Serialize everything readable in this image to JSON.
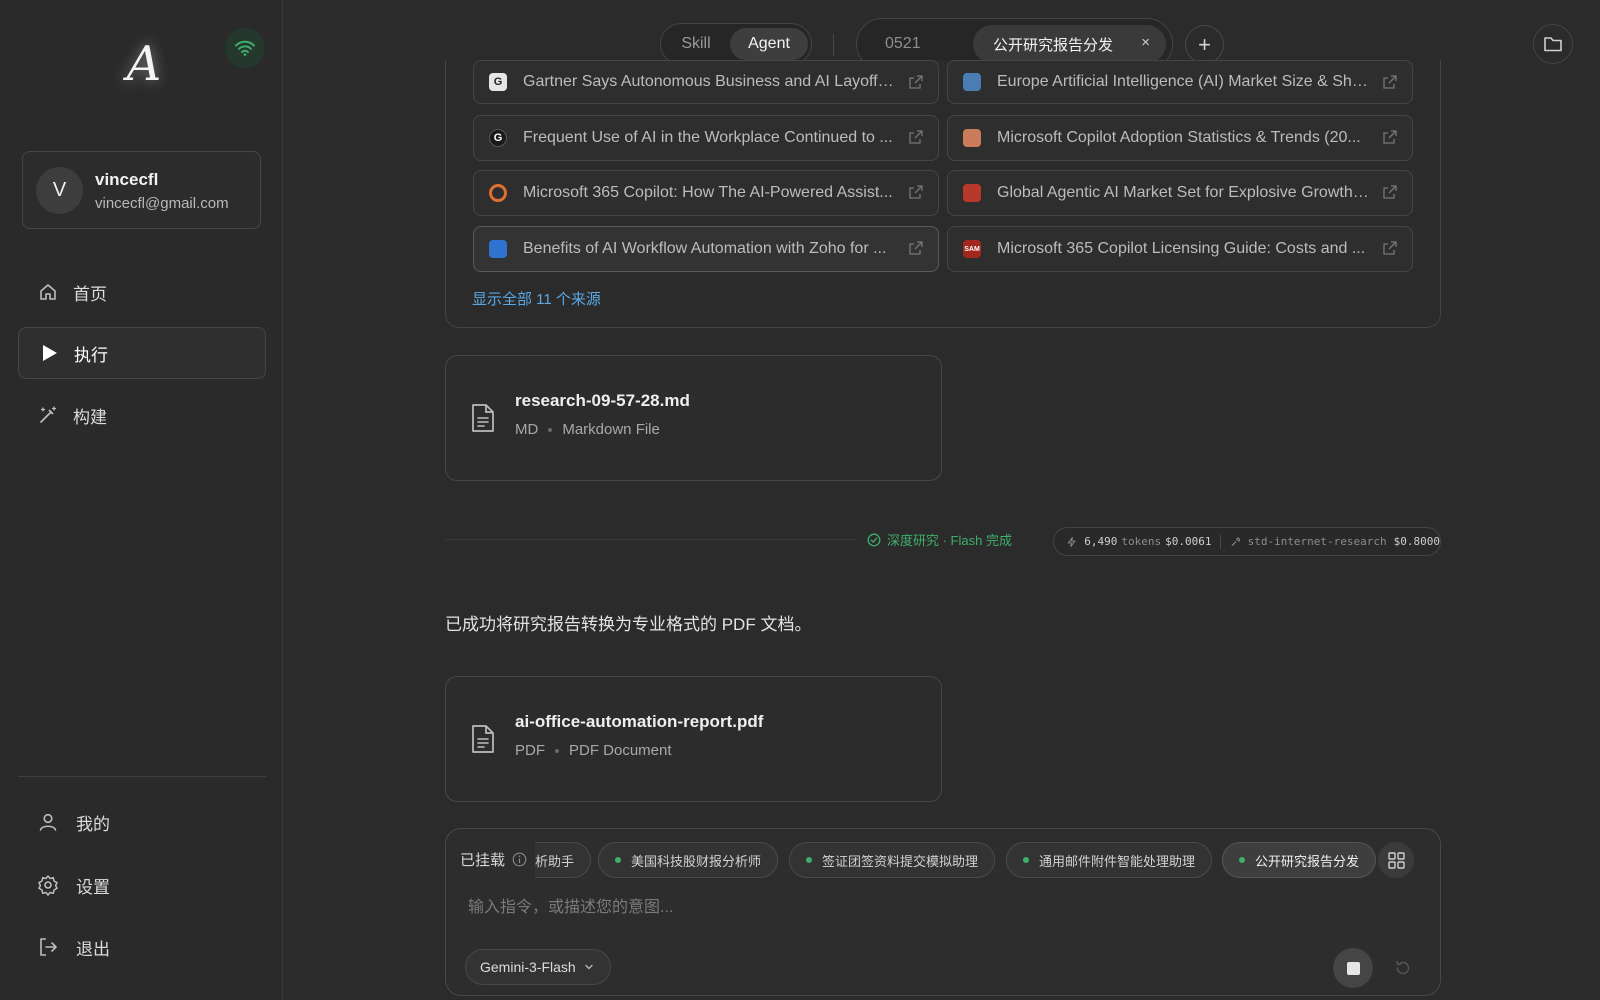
{
  "app": {
    "logo_letter": "A"
  },
  "user": {
    "initial": "V",
    "name": "vincecfl",
    "email": "vincecfl@gmail.com"
  },
  "nav": [
    {
      "label": "首页",
      "icon": "home-icon"
    },
    {
      "label": "执行",
      "icon": "play-icon",
      "active": true
    },
    {
      "label": "构建",
      "icon": "magic-wand-icon"
    }
  ],
  "bottom_nav": [
    {
      "label": "我的",
      "icon": "user-icon"
    },
    {
      "label": "设置",
      "icon": "gear-icon"
    },
    {
      "label": "退出",
      "icon": "logout-icon"
    }
  ],
  "topbar": {
    "mode_skill": "Skill",
    "mode_agent": "Agent",
    "session_date": "0521",
    "session_tab": "公开研究报告分发",
    "close_glyph": "×",
    "plus_glyph": "+"
  },
  "sources": [
    {
      "title": "Gartner Says Autonomous Business and AI Layoffs ...",
      "fav": "G",
      "fav_color": "#e6e6e6"
    },
    {
      "title": "Europe Artificial Intelligence (AI) Market Size & Sha...",
      "fav": "",
      "fav_color": "#4a7db3"
    },
    {
      "title": "Frequent Use of AI in the Workplace Continued to ...",
      "fav": "G",
      "fav_color": "#1a1a1a"
    },
    {
      "title": "Microsoft Copilot Adoption Statistics & Trends (20...",
      "fav": "",
      "fav_color": "#c97b5a"
    },
    {
      "title": "Microsoft 365 Copilot: How The AI-Powered Assist...",
      "fav": "",
      "fav_color": "#e0702f"
    },
    {
      "title": "Global Agentic AI Market Set for Explosive Growth: ...",
      "fav": "",
      "fav_color": "#b8382c"
    },
    {
      "title": "Benefits of AI Workflow Automation with Zoho for ...",
      "fav": "",
      "fav_color": "#2f74d0"
    },
    {
      "title": "Microsoft 365 Copilot Licensing Guide: Costs and ...",
      "fav": "SAM",
      "fav_color": "#a3261f"
    }
  ],
  "show_all_sources": "显示全部 11 个来源",
  "files": [
    {
      "name": "research-09-57-28.md",
      "ext": "MD",
      "type": "Markdown File"
    },
    {
      "name": "ai-office-automation-report.pdf",
      "ext": "PDF",
      "type": "PDF Document"
    }
  ],
  "status": {
    "done_text": "深度研究 · Flash 完成",
    "tokens_value": "6,490",
    "tokens_label": "tokens",
    "tokens_cost": "$0.0061",
    "tool_name": "std-internet-research",
    "tool_cost": "$0.8000"
  },
  "message": "已成功将研究报告转换为专业格式的 PDF 文档。",
  "composer": {
    "mounted_label": "已挂载",
    "chips": [
      {
        "label": "析助手",
        "clipped": true
      },
      {
        "label": "美国科技股财报分析师"
      },
      {
        "label": "签证团签资料提交模拟助理"
      },
      {
        "label": "通用邮件附件智能处理助理"
      },
      {
        "label": "公开研究报告分发",
        "active": true
      }
    ],
    "placeholder": "输入指令，或描述您的意图...",
    "model": "Gemini-3-Flash"
  },
  "colors": {
    "accent_green": "#3fae6b",
    "link_blue": "#5aa8e6",
    "background": "#2b2b2b"
  }
}
